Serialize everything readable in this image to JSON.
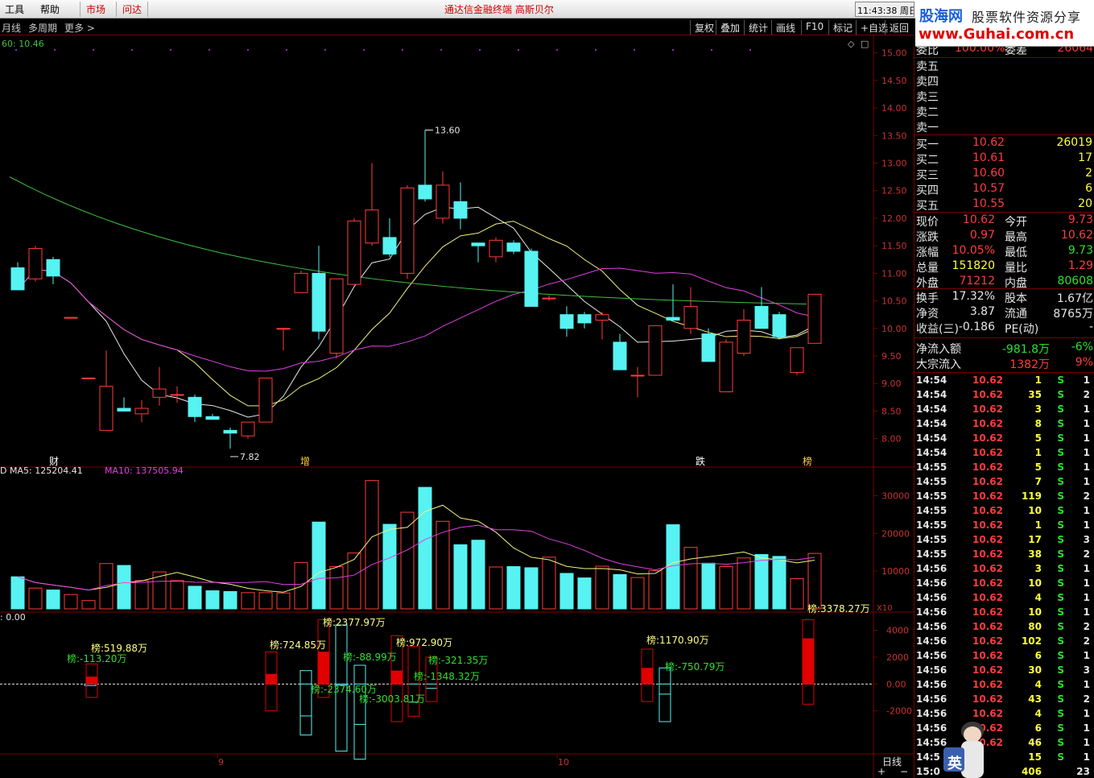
{
  "menubar": {
    "items": [
      "工具",
      "帮助",
      "市场",
      "问达"
    ],
    "title": "通达信金融终端 高斯贝尔",
    "clock": "11:43:38 周日"
  },
  "logo": {
    "name": "股海网",
    "subtitle": "股票软件资源分享",
    "url": "www.Guhai.com.cn"
  },
  "toolbar": {
    "left": [
      "月线",
      "多周期",
      "更多 >"
    ],
    "buttons": [
      "复权",
      "叠加",
      "统计",
      "画线",
      "F10",
      "标记",
      "+自选",
      "返回"
    ]
  },
  "price_chart": {
    "ma_label": "60: 10.46",
    "y_ticks": [
      "15.00",
      "14.50",
      "14.00",
      "13.50",
      "13.00",
      "12.50",
      "12.00",
      "11.50",
      "11.00",
      "10.50",
      "10.00",
      "9.50",
      "9.00",
      "8.50",
      "8.00"
    ],
    "high_label": "13.60",
    "low_label": "7.82",
    "markers": [
      "财",
      "增",
      "跌",
      "榜"
    ]
  },
  "volume_chart": {
    "label_prefix": "D",
    "ma5": "MA5: 125204.41",
    "ma10": "MA10: 137505.94",
    "y_ticks": [
      "30000",
      "20000",
      "10000"
    ],
    "unit": "X10"
  },
  "flow_chart": {
    "label": ": 0.00",
    "y_ticks": [
      "4000",
      "2000",
      "0.00",
      "-2000"
    ],
    "annotations": [
      "榜:519.88万",
      "榜:-113.20万",
      "榜:724.85万",
      "榜:2377.97万",
      "榜:-2374.60万",
      "榜:-88.99万",
      "榜:-3003.81万",
      "榜:972.90万",
      "榜:-1348.32万",
      "榜:-321.35万",
      "榜:1170.90万",
      "榜:-750.79万",
      "榜:3378.27万"
    ]
  },
  "x_axis": {
    "labels": [
      "9",
      "10"
    ],
    "period": "日线"
  },
  "chart_data": {
    "type": "candlestick",
    "y_range": [
      7.6,
      15.2
    ],
    "candles": [
      {
        "o": 11.1,
        "h": 11.2,
        "l": 10.7,
        "c": 10.7
      },
      {
        "o": 10.9,
        "h": 11.5,
        "l": 10.85,
        "c": 11.45
      },
      {
        "o": 11.25,
        "h": 11.3,
        "l": 10.8,
        "c": 10.95
      },
      {
        "o": 10.2,
        "h": 10.2,
        "l": 10.2,
        "c": 10.2
      },
      {
        "o": 9.1,
        "h": 9.1,
        "l": 9.1,
        "c": 9.1
      },
      {
        "o": 8.15,
        "h": 9.6,
        "l": 8.15,
        "c": 8.95
      },
      {
        "o": 8.55,
        "h": 8.75,
        "l": 8.5,
        "c": 8.5
      },
      {
        "o": 8.45,
        "h": 8.7,
        "l": 8.3,
        "c": 8.55
      },
      {
        "o": 8.75,
        "h": 9.3,
        "l": 8.6,
        "c": 8.9
      },
      {
        "o": 8.8,
        "h": 8.95,
        "l": 8.65,
        "c": 8.8
      },
      {
        "o": 8.75,
        "h": 8.8,
        "l": 8.3,
        "c": 8.4
      },
      {
        "o": 8.4,
        "h": 8.45,
        "l": 8.35,
        "c": 8.35
      },
      {
        "o": 8.15,
        "h": 8.2,
        "l": 7.82,
        "c": 8.1
      },
      {
        "o": 8.05,
        "h": 8.3,
        "l": 8.0,
        "c": 8.3
      },
      {
        "o": 8.3,
        "h": 9.1,
        "l": 8.3,
        "c": 9.1
      },
      {
        "o": 10.0,
        "h": 10.0,
        "l": 9.6,
        "c": 10.0
      },
      {
        "o": 10.65,
        "h": 11.05,
        "l": 10.65,
        "c": 11.0
      },
      {
        "o": 11.0,
        "h": 11.5,
        "l": 9.8,
        "c": 9.95
      },
      {
        "o": 9.55,
        "h": 10.9,
        "l": 9.45,
        "c": 10.9
      },
      {
        "o": 10.8,
        "h": 12.0,
        "l": 10.8,
        "c": 11.95
      },
      {
        "o": 11.55,
        "h": 13.0,
        "l": 11.5,
        "c": 12.15
      },
      {
        "o": 11.65,
        "h": 12.0,
        "l": 11.3,
        "c": 11.35
      },
      {
        "o": 11.0,
        "h": 12.6,
        "l": 10.9,
        "c": 12.55
      },
      {
        "o": 12.6,
        "h": 13.6,
        "l": 12.3,
        "c": 12.35
      },
      {
        "o": 12.0,
        "h": 12.85,
        "l": 11.9,
        "c": 12.6
      },
      {
        "o": 12.3,
        "h": 12.65,
        "l": 11.8,
        "c": 12.0
      },
      {
        "o": 11.55,
        "h": 11.5,
        "l": 11.2,
        "c": 11.5
      },
      {
        "o": 11.3,
        "h": 11.65,
        "l": 11.2,
        "c": 11.6
      },
      {
        "o": 11.55,
        "h": 11.6,
        "l": 11.35,
        "c": 11.4
      },
      {
        "o": 11.4,
        "h": 11.45,
        "l": 10.4,
        "c": 10.4
      },
      {
        "o": 10.55,
        "h": 10.6,
        "l": 10.5,
        "c": 10.55
      },
      {
        "o": 10.25,
        "h": 10.4,
        "l": 9.85,
        "c": 10.0
      },
      {
        "o": 10.25,
        "h": 10.3,
        "l": 10.0,
        "c": 10.1
      },
      {
        "o": 10.15,
        "h": 10.3,
        "l": 9.8,
        "c": 10.25
      },
      {
        "o": 9.75,
        "h": 9.9,
        "l": 9.25,
        "c": 9.25
      },
      {
        "o": 9.15,
        "h": 9.3,
        "l": 8.75,
        "c": 9.15
      },
      {
        "o": 9.15,
        "h": 10.05,
        "l": 9.15,
        "c": 10.05
      },
      {
        "o": 10.2,
        "h": 10.8,
        "l": 10.15,
        "c": 10.15
      },
      {
        "o": 10.0,
        "h": 10.75,
        "l": 9.9,
        "c": 10.4
      },
      {
        "o": 9.9,
        "h": 10.0,
        "l": 9.4,
        "c": 9.4
      },
      {
        "o": 8.85,
        "h": 9.8,
        "l": 8.85,
        "c": 9.75
      },
      {
        "o": 9.55,
        "h": 10.35,
        "l": 9.5,
        "c": 10.15
      },
      {
        "o": 10.4,
        "h": 10.75,
        "l": 10.0,
        "c": 10.0
      },
      {
        "o": 10.25,
        "h": 10.3,
        "l": 9.8,
        "c": 9.85
      },
      {
        "o": 9.2,
        "h": 9.65,
        "l": 9.15,
        "c": 9.65
      },
      {
        "o": 9.73,
        "h": 10.62,
        "l": 9.73,
        "c": 10.62
      }
    ],
    "volume_range": [
      0,
      35000
    ],
    "volume": [
      8500,
      5500,
      5000,
      3800,
      2200,
      12000,
      11500,
      7500,
      9800,
      7500,
      6000,
      4800,
      4600,
      4300,
      4300,
      4200,
      12300,
      23000,
      11200,
      14800,
      34000,
      22400,
      25600,
      32200,
      23200,
      17000,
      18200,
      11100,
      11200,
      10900,
      13700,
      9400,
      8200,
      11300,
      9100,
      8300,
      10100,
      22300,
      16300,
      12100,
      11200,
      13500,
      14400,
      13900,
      8000,
      14700
    ],
    "flow_range": [
      -5200,
      5000
    ],
    "flow": [
      0,
      0,
      0,
      0,
      -113,
      520,
      0,
      0,
      0,
      0,
      0,
      0,
      0,
      0,
      725,
      -2375,
      2378,
      -89,
      -3004,
      973,
      -1348,
      -321,
      0,
      0,
      0,
      0,
      0,
      0,
      0,
      0,
      0,
      0,
      1171,
      -751,
      0,
      3378
    ]
  },
  "quote": {
    "weibi": {
      "label": "委比",
      "value": "100.00%",
      "label2": "委差",
      "value2": "26064"
    },
    "sell": [
      {
        "label": "卖五"
      },
      {
        "label": "卖四"
      },
      {
        "label": "卖三"
      },
      {
        "label": "卖二"
      },
      {
        "label": "卖一"
      }
    ],
    "buy": [
      {
        "label": "买一",
        "price": "10.62",
        "vol": "26019"
      },
      {
        "label": "买二",
        "price": "10.61",
        "vol": "17"
      },
      {
        "label": "买三",
        "price": "10.60",
        "vol": "2"
      },
      {
        "label": "买四",
        "price": "10.57",
        "vol": "6"
      },
      {
        "label": "买五",
        "price": "10.55",
        "vol": "20"
      }
    ],
    "stats": [
      {
        "l1": "现价",
        "v1": "10.62",
        "l2": "今开",
        "v2": "9.73"
      },
      {
        "l1": "涨跌",
        "v1": "0.97",
        "l2": "最高",
        "v2": "10.62"
      },
      {
        "l1": "涨幅",
        "v1": "10.05%",
        "l2": "最低",
        "v2": "9.73"
      },
      {
        "l1": "总量",
        "v1": "151820",
        "l2": "量比",
        "v2": "1.29"
      },
      {
        "l1": "外盘",
        "v1": "71212",
        "l2": "内盘",
        "v2": "80608"
      },
      {
        "l1": "换手",
        "v1": "17.32%",
        "l2": "股本",
        "v2": "1.67亿"
      },
      {
        "l1": "净资",
        "v1": "3.87",
        "l2": "流通",
        "v2": "8765万"
      },
      {
        "l1": "收益(三)",
        "v1": "-0.186",
        "l2": "PE(动)",
        "v2": "-"
      }
    ],
    "flows": [
      {
        "label": "净流入额",
        "value": "-981.8万",
        "pct": "-6%"
      },
      {
        "label": "大宗流入",
        "value": "1382万",
        "pct": "9%"
      }
    ]
  },
  "ticks": [
    {
      "t": "14:54",
      "p": "10.62",
      "v": "1",
      "s": "S",
      "n": "1"
    },
    {
      "t": "14:54",
      "p": "10.62",
      "v": "35",
      "s": "S",
      "n": "2"
    },
    {
      "t": "14:54",
      "p": "10.62",
      "v": "3",
      "s": "S",
      "n": "1"
    },
    {
      "t": "14:54",
      "p": "10.62",
      "v": "8",
      "s": "S",
      "n": "1"
    },
    {
      "t": "14:54",
      "p": "10.62",
      "v": "5",
      "s": "S",
      "n": "1"
    },
    {
      "t": "14:54",
      "p": "10.62",
      "v": "1",
      "s": "S",
      "n": "1"
    },
    {
      "t": "14:55",
      "p": "10.62",
      "v": "5",
      "s": "S",
      "n": "1"
    },
    {
      "t": "14:55",
      "p": "10.62",
      "v": "7",
      "s": "S",
      "n": "1"
    },
    {
      "t": "14:55",
      "p": "10.62",
      "v": "119",
      "s": "S",
      "n": "2"
    },
    {
      "t": "14:55",
      "p": "10.62",
      "v": "10",
      "s": "S",
      "n": "1"
    },
    {
      "t": "14:55",
      "p": "10.62",
      "v": "1",
      "s": "S",
      "n": "1"
    },
    {
      "t": "14:55",
      "p": "10.62",
      "v": "17",
      "s": "S",
      "n": "3"
    },
    {
      "t": "14:55",
      "p": "10.62",
      "v": "38",
      "s": "S",
      "n": "2"
    },
    {
      "t": "14:56",
      "p": "10.62",
      "v": "3",
      "s": "S",
      "n": "1"
    },
    {
      "t": "14:56",
      "p": "10.62",
      "v": "10",
      "s": "S",
      "n": "1"
    },
    {
      "t": "14:56",
      "p": "10.62",
      "v": "4",
      "s": "S",
      "n": "1"
    },
    {
      "t": "14:56",
      "p": "10.62",
      "v": "10",
      "s": "S",
      "n": "1"
    },
    {
      "t": "14:56",
      "p": "10.62",
      "v": "80",
      "s": "S",
      "n": "2"
    },
    {
      "t": "14:56",
      "p": "10.62",
      "v": "102",
      "s": "S",
      "n": "2"
    },
    {
      "t": "14:56",
      "p": "10.62",
      "v": "6",
      "s": "S",
      "n": "1"
    },
    {
      "t": "14:56",
      "p": "10.62",
      "v": "30",
      "s": "S",
      "n": "3"
    },
    {
      "t": "14:56",
      "p": "10.62",
      "v": "4",
      "s": "S",
      "n": "1"
    },
    {
      "t": "14:56",
      "p": "10.62",
      "v": "43",
      "s": "S",
      "n": "2"
    },
    {
      "t": "14:56",
      "p": "10.62",
      "v": "4",
      "s": "S",
      "n": "1"
    },
    {
      "t": "14:56",
      "p": "10.62",
      "v": "6",
      "s": "S",
      "n": "1"
    },
    {
      "t": "14:56",
      "p": "10.62",
      "v": "46",
      "s": "S",
      "n": "1"
    },
    {
      "t": "14:5",
      "p": "",
      "v": "15",
      "s": "S",
      "n": "1"
    },
    {
      "t": "15:0",
      "p": "",
      "v": "406",
      "s": "",
      "n": "23"
    }
  ],
  "avatar_text": "英",
  "colors": {
    "up": "#ff3c3c",
    "down": "#57f2f2",
    "ma_white": "#e8e8e8",
    "ma_yellow": "#f0f080",
    "ma_magenta": "#e040e0",
    "ma_green": "#40c040",
    "border": "#7a0000"
  }
}
